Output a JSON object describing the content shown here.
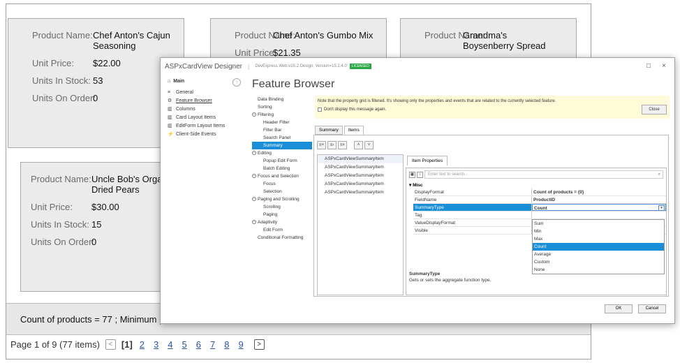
{
  "cards": [
    {
      "name_label": "Product Name:",
      "name": "Chef Anton's Cajun Seasoning",
      "price_label": "Unit Price:",
      "price": "$22.00",
      "stock_label": "Units In Stock:",
      "stock": "53",
      "order_label": "Units On Order:",
      "order": "0"
    },
    {
      "name_label": "Product Name:",
      "name": "Chef Anton's Gumbo Mix",
      "price_label": "Unit Price:",
      "price": "$21.35"
    },
    {
      "name_label": "Product Name:",
      "name": "Grandma's Boysenberry Spread"
    },
    {
      "name_label": "Product Name:",
      "name": "Uncle Bob's Organic Dried Pears",
      "price_label": "Unit Price:",
      "price": "$30.00",
      "stock_label": "Units In Stock:",
      "stock": "15",
      "order_label": "Units On Order:",
      "order": "0"
    }
  ],
  "summary_text": "Count of products = 77 ;  Minimum p",
  "pager": {
    "info": "Page 1 of 9 (77 items)",
    "prev": "<",
    "current": "[1]",
    "pages": [
      "2",
      "3",
      "4",
      "5",
      "6",
      "7",
      "8",
      "9"
    ],
    "next": ">"
  },
  "dialog": {
    "title": "ASPxCardView Designer",
    "version": "DevExpress.Web.v15.2.Design, Version=15.2.4.0",
    "license": "LICENSED",
    "win_max": "□",
    "win_close": "×",
    "nav_head": "Main",
    "nav_items": [
      {
        "icon": "≡",
        "label": "General"
      },
      {
        "icon": "⚙",
        "label": "Feature Browser"
      },
      {
        "icon": "▥",
        "label": "Columns"
      },
      {
        "icon": "▥",
        "label": "Card Layout Items"
      },
      {
        "icon": "▥",
        "label": "EditForm Layout Items"
      },
      {
        "icon": "⚡",
        "label": "Client-Side Events"
      }
    ],
    "heading": "Feature Browser",
    "tree": [
      {
        "label": "Data Binding",
        "lvl": "l0"
      },
      {
        "label": "Sorting",
        "lvl": "l0"
      },
      {
        "label": "Filtering",
        "lvl": "l0c",
        "collapse": "⊖"
      },
      {
        "label": "Header Filter",
        "lvl": "l1"
      },
      {
        "label": "Filter Bar",
        "lvl": "l1"
      },
      {
        "label": "Search Panel",
        "lvl": "l1"
      },
      {
        "label": "Summary",
        "lvl": "l1",
        "selected": true
      },
      {
        "label": "Editing",
        "lvl": "l0c",
        "collapse": "⊖"
      },
      {
        "label": "Popup Edit Form",
        "lvl": "l1"
      },
      {
        "label": "Batch Editing",
        "lvl": "l1"
      },
      {
        "label": "Focus and Selection",
        "lvl": "l0c",
        "collapse": "⊖"
      },
      {
        "label": "Focus",
        "lvl": "l1"
      },
      {
        "label": "Selection",
        "lvl": "l1"
      },
      {
        "label": "Paging and Scrolling",
        "lvl": "l0c",
        "collapse": "⊖"
      },
      {
        "label": "Scrolling",
        "lvl": "l1"
      },
      {
        "label": "Paging",
        "lvl": "l1"
      },
      {
        "label": "Adaptivity",
        "lvl": "l0c",
        "collapse": "⊖"
      },
      {
        "label": "Edit Form",
        "lvl": "l1"
      },
      {
        "label": "Conditional Formatting",
        "lvl": "l0"
      }
    ],
    "note": "Note that the property grid is filtered. It's showing only the properties and events that are related to the currently selected feature.",
    "dont_display": "Don't display this message again.",
    "close_label": "Close",
    "tabs": [
      "Summary",
      "Items"
    ],
    "items": [
      "ASPxCardViewSummaryItem",
      "ASPxCardViewSummaryItem",
      "ASPxCardViewSummaryItem",
      "ASPxCardViewSummaryItem",
      "ASPxCardViewSummaryItem"
    ],
    "item_props_tab": "Item Properties",
    "search_placeholder": "Enter text to search...",
    "misc": "Misc",
    "props": [
      {
        "k": "DisplayFormat",
        "v": "Count of products = {0}"
      },
      {
        "k": "FieldName",
        "v": "ProductID"
      },
      {
        "k": "SummaryType",
        "v": "Count",
        "selected": true
      },
      {
        "k": "Tag",
        "v": ""
      },
      {
        "k": "ValueDisplayFormat",
        "v": ""
      },
      {
        "k": "Visible",
        "v": ""
      }
    ],
    "dropdown": [
      "Sum",
      "Min",
      "Max",
      "Count",
      "Average",
      "Custom",
      "None"
    ],
    "dropdown_selected": "Count",
    "desc_title": "SummaryType",
    "desc_text": "Gets or sets the aggregate function type.",
    "ok": "OK",
    "cancel": "Cancel"
  }
}
